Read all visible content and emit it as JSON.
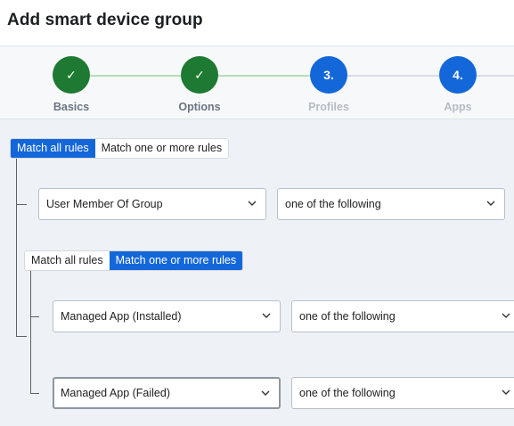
{
  "header": {
    "title": "Add smart device group"
  },
  "stepper": {
    "steps": [
      {
        "label": "Basics",
        "marker": "✓",
        "state": "done"
      },
      {
        "label": "Options",
        "marker": "✓",
        "state": "done"
      },
      {
        "label": "Profiles",
        "marker": "3.",
        "state": "pending"
      },
      {
        "label": "Apps",
        "marker": "4.",
        "state": "pending"
      }
    ]
  },
  "rules": {
    "outer_toggle": {
      "all": "Match all rules",
      "any": "Match one or more rules",
      "selected": "all"
    },
    "rule1": {
      "field": "User Member Of Group",
      "operator": "one of the following"
    },
    "inner_toggle": {
      "all": "Match all rules",
      "any": "Match one or more rules",
      "selected": "any"
    },
    "rule2": {
      "field": "Managed App (Installed)",
      "operator": "one of the following"
    },
    "rule3": {
      "field": "Managed App (Failed)",
      "operator": "one of the following"
    }
  },
  "colors": {
    "accent": "#1467d9",
    "done": "#1e7a32",
    "connector": "#5b6066"
  },
  "icons": {
    "done_step": "check-icon",
    "dropdown": "chevron-down-icon"
  }
}
